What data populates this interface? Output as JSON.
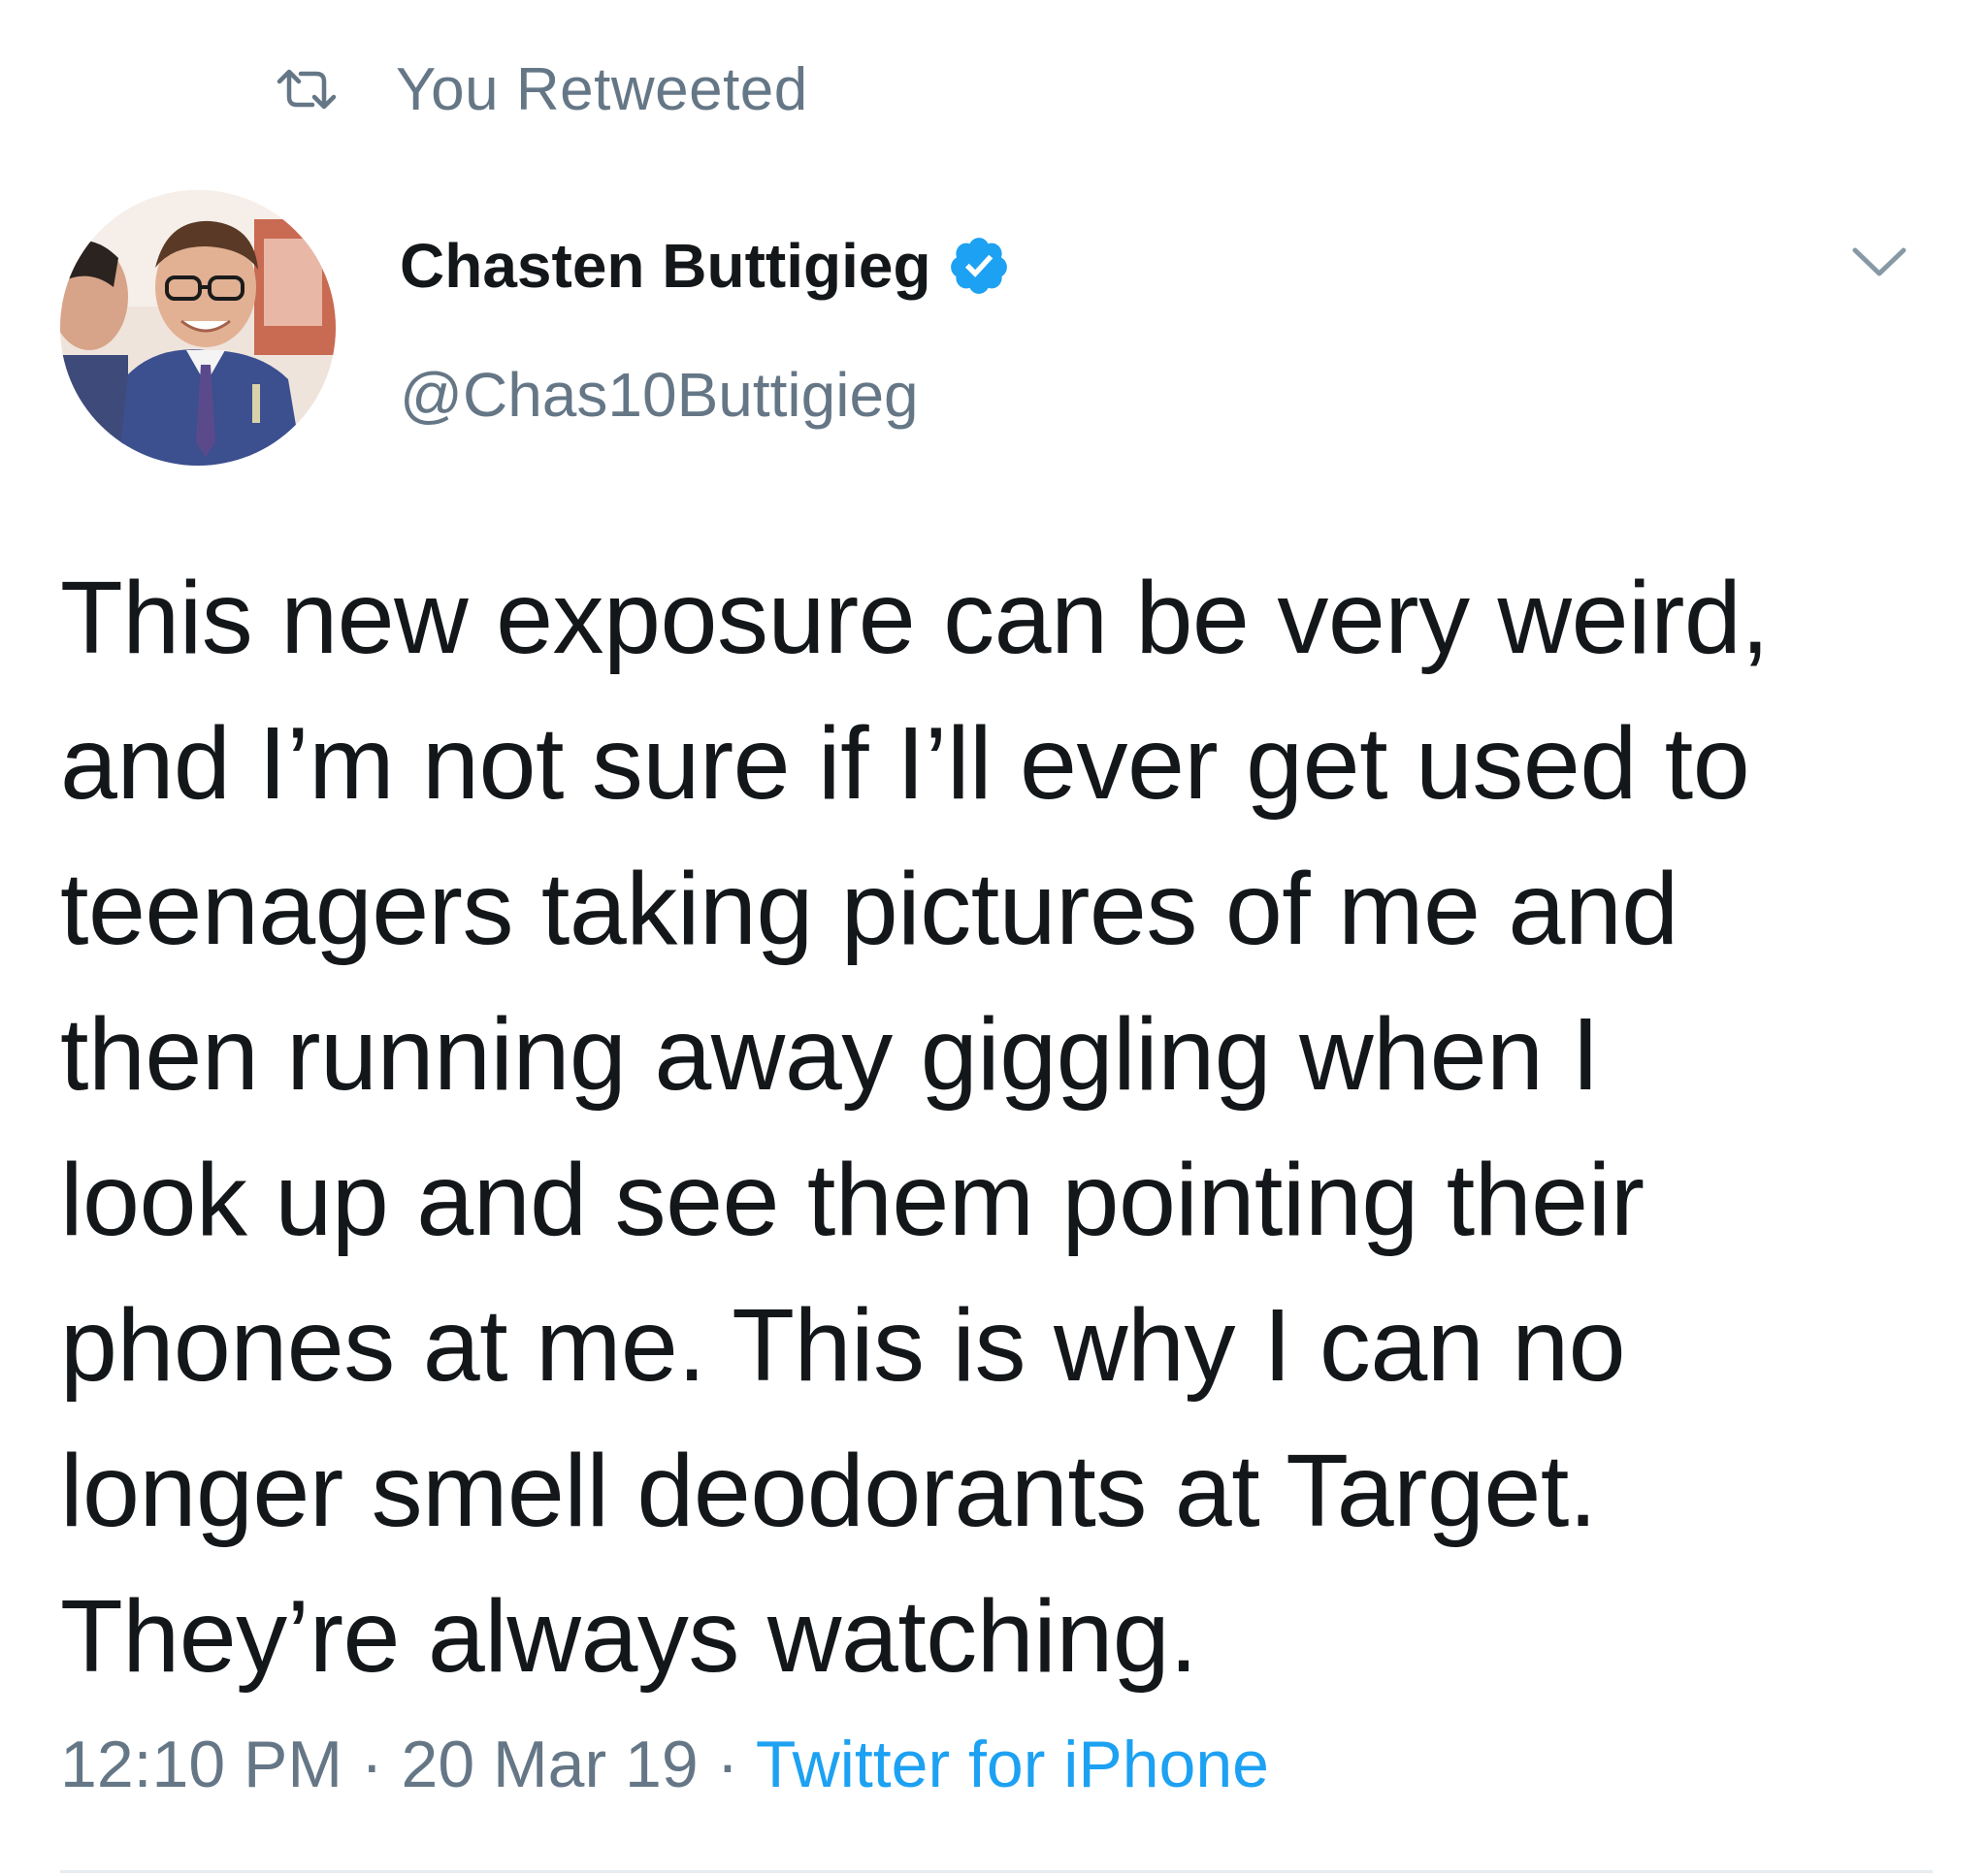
{
  "retweet": {
    "icon": "retweet-icon",
    "label": "You Retweeted"
  },
  "author": {
    "avatar": "avatar-photo",
    "display_name": "Chasten Buttigieg",
    "verified_icon": "verified-badge-icon",
    "handle": "@Chas10Buttigieg"
  },
  "menu": {
    "icon": "chevron-down-icon"
  },
  "tweet": {
    "text": "This new exposure can be very weird,\nand I’m not sure if I’ll ever get used to\nteenagers taking pictures of me and\nthen running away giggling when I\nlook up and see them pointing their\nphones at me. This is why I can no\nlonger smell deodorants at Target.\nThey’re always watching."
  },
  "meta": {
    "time": "12:10 PM",
    "separator": " · ",
    "date": "20 Mar 19",
    "source": "Twitter for iPhone"
  },
  "colors": {
    "text": "#14171a",
    "secondary": "#657786",
    "link": "#1da1f2",
    "verified": "#1da1f2",
    "divider": "#e6ecf0"
  }
}
